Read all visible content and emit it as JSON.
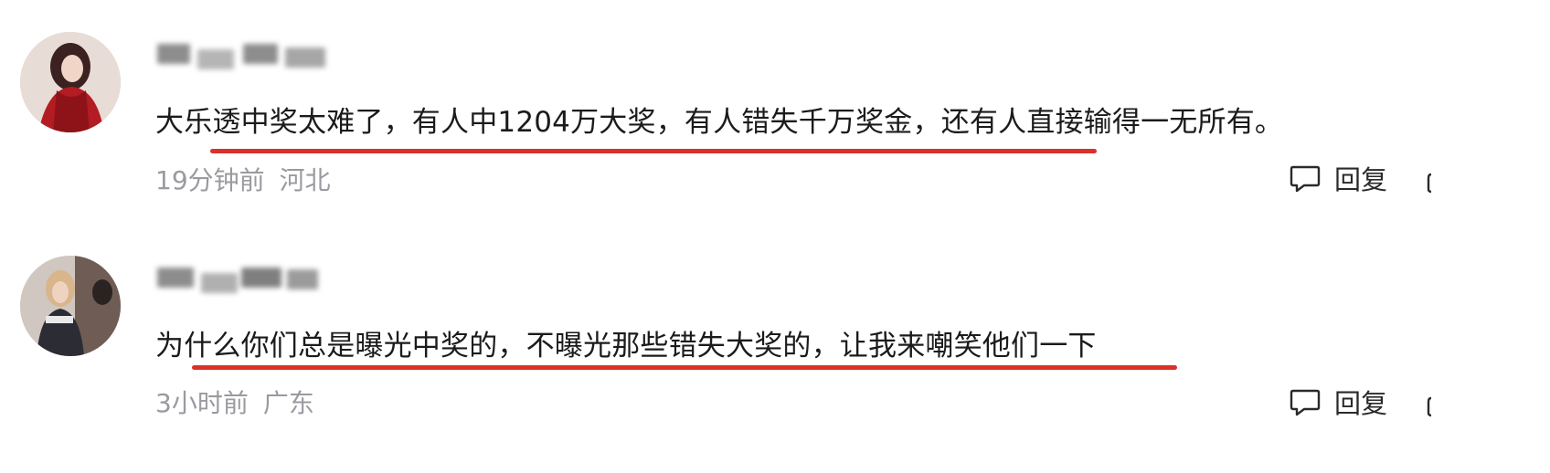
{
  "comments": [
    {
      "text": "大乐透中奖太难了，有人中1204万大奖，有人错失千万奖金，还有人直接输得一无所有。",
      "time": "19分钟前",
      "region": "河北",
      "reply_label": "回复"
    },
    {
      "text": "为什么你们总是曝光中奖的，不曝光那些错失大奖的，让我来嘲笑他们一下",
      "time": "3小时前",
      "region": "广东",
      "reply_label": "回复"
    }
  ],
  "colors": {
    "underline": "#d9322b",
    "meta_text": "#9a9aa0",
    "body_text": "#1b1b1b"
  },
  "icons": [
    "reply-icon",
    "like-icon"
  ]
}
